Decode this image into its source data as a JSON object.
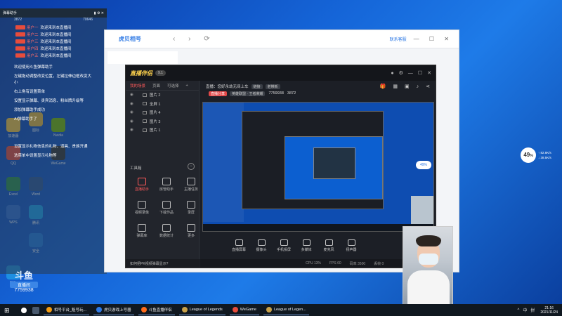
{
  "desktop": {
    "icons": [
      {
        "label": "加速器",
        "color": "#f5c542"
      },
      {
        "label": "Nvidia",
        "color": "#76b900"
      },
      {
        "label": "QQ",
        "color": "#e74c3c"
      },
      {
        "label": "WeGame",
        "color": "#333333"
      },
      {
        "label": "WPS",
        "color": "#2f6fd6"
      },
      {
        "label": "腾讯",
        "color": "#1aa1f0"
      },
      {
        "label": "Excel",
        "color": "#2a8f4d"
      },
      {
        "label": "Word",
        "color": "#2b579a"
      },
      {
        "label": "图标",
        "color": "#e8b93c"
      },
      {
        "label": "安全",
        "color": "#1f7ae0"
      },
      {
        "label": "酷狗",
        "color": "#1d8fe1"
      }
    ]
  },
  "chat": {
    "title": "弹幕助手",
    "stats": [
      "3872",
      "70646"
    ],
    "lines": [
      {
        "user": "用户一",
        "text": "欢迎来到本直播间"
      },
      {
        "user": "用户二",
        "text": "欢迎来到本直播间"
      },
      {
        "user": "用户三",
        "text": "欢迎来到本直播间"
      },
      {
        "user": "用户四",
        "text": "欢迎来到本直播间"
      },
      {
        "user": "用户五",
        "text": "欢迎来到本直播间"
      }
    ],
    "notes": [
      "欢迎使用斗鱼弹幕助手",
      "左键拖动调整改变位置，左键拉伸边框改变大小",
      "右上角有设置菜单",
      "设置显示弹幕、贵宾消息、粉丝牌升级等",
      "添加弹幕助手成功",
      "AI弹幕助手了",
      "设置显示礼物信息的礼物、道具、贵族开通",
      "选菜单中设置显示礼物等"
    ]
  },
  "helper": {
    "logo": "虎贝相号",
    "nav": "‹ › ⟳",
    "link": "联系客服",
    "win": "— ☐ ✕"
  },
  "live": {
    "brand": "直播伴侣",
    "version": "9.1",
    "tabs": [
      "我的场景",
      "页面",
      "可选择"
    ],
    "scenes": [
      "图片 2",
      "全屏 1",
      "图片 4",
      "图片 3",
      "图片 1"
    ],
    "tools_title": "工具箱",
    "tools": [
      {
        "label": "直播助手",
        "red": true
      },
      {
        "label": "房管助手",
        "red": false
      },
      {
        "label": "主播任务",
        "red": false
      },
      {
        "label": "视频录像",
        "red": false
      },
      {
        "label": "下载作品",
        "red": false
      },
      {
        "label": "录屏",
        "red": false
      },
      {
        "label": "弹幕库",
        "red": false
      },
      {
        "label": "数据统计",
        "red": false
      },
      {
        "label": "更多",
        "red": false
      }
    ],
    "tip": "如何把PK视频弹幕显示?",
    "info_row1": {
      "label": "直播：",
      "title": "您好永劫无间上车",
      "tag": "链接",
      "tag2": "老带新"
    },
    "info_row2": {
      "tag_red": "直播分享",
      "category": "英雄联盟 · 王者荣耀",
      "room": "7759938",
      "fans": "3872"
    },
    "bottom": [
      "直播屏幕",
      "摄像头",
      "手机投屏",
      "多媒体",
      "麦克风",
      "扬声器"
    ],
    "status": [
      "CPU 13%",
      "FPS 60",
      "码率 3500",
      "丢帧 0"
    ]
  },
  "perf": {
    "value": "49",
    "unit": "%",
    "line1": "↑ 82.8K/s",
    "line2": "↓ 38.5K/s"
  },
  "float_badge": "49%",
  "room": {
    "logo": "斗鱼",
    "sub": "直播间",
    "id": "7759938"
  },
  "taskbar": {
    "items": [
      {
        "label": "相号平台_租号玩...",
        "color": "#f39c12"
      },
      {
        "label": "虎贝游戏上号器",
        "color": "#2f7ae5"
      },
      {
        "label": "斗鱼直播伴侣",
        "color": "#ff6b1a"
      },
      {
        "label": "League of Legends",
        "color": "#c7a14a"
      },
      {
        "label": "WeGame",
        "color": "#e74c3c"
      },
      {
        "label": "League of Legen...",
        "color": "#c7a14a"
      }
    ],
    "tray": [
      "^",
      "中",
      "拼"
    ],
    "time": "21:16",
    "date": "2021/11/24"
  }
}
